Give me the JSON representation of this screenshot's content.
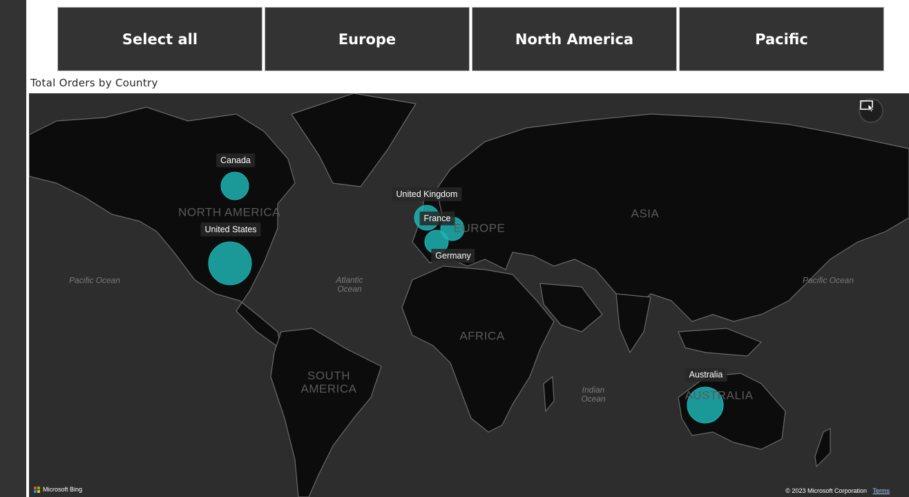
{
  "slicer": {
    "buttons": [
      "Select all",
      "Europe",
      "North America",
      "Pacific"
    ]
  },
  "visual": {
    "title": "Total Orders by Country"
  },
  "map": {
    "bubble_color": "#1fb7b7",
    "countries": [
      "Canada",
      "United States",
      "United Kingdom",
      "France",
      "Germany",
      "Australia"
    ],
    "region_labels": {
      "north_america": "NORTH AMERICA",
      "europe": "EUROPE",
      "asia": "ASIA",
      "africa": "AFRICA",
      "south_america_line1": "SOUTH",
      "south_america_line2": "AMERICA",
      "australia": "AUSTRALIA"
    },
    "ocean_labels": {
      "pacific_west": "Pacific Ocean",
      "atlantic_line1": "Atlantic",
      "atlantic_line2": "Ocean",
      "indian_line1": "Indian",
      "indian_line2": "Ocean",
      "pacific_east": "Pacific Ocean"
    },
    "attribution": {
      "brand": "Microsoft Bing",
      "copyright": "© 2023 Microsoft Corporation",
      "terms": "Terms"
    },
    "focus_mode_icon": "focus-mode-icon"
  }
}
